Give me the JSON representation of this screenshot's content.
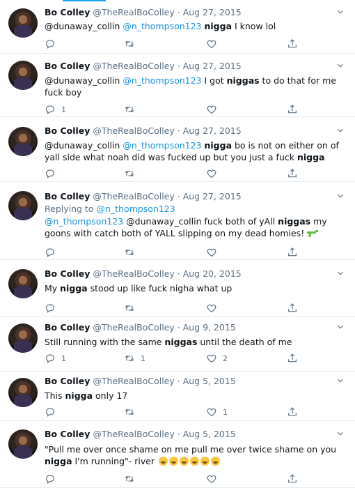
{
  "tweets": [
    {
      "name": "Bo Colley",
      "handle": "@TheRealBoColley",
      "sep": "·",
      "date": "Aug 27, 2015",
      "reply_label": "",
      "reply_to": "",
      "segments": [
        {
          "t": "@dunaway_collin ",
          "s": "text"
        },
        {
          "t": "@n_thompson123",
          "s": "mention"
        },
        {
          "t": " ",
          "s": "text"
        },
        {
          "t": "nigga",
          "s": "bold"
        },
        {
          "t": " I know lol",
          "s": "text"
        }
      ],
      "counts": {
        "replies": "",
        "retweets": "",
        "likes": ""
      }
    },
    {
      "name": "Bo Colley",
      "handle": "@TheRealBoColley",
      "sep": "·",
      "date": "Aug 27, 2015",
      "reply_label": "",
      "reply_to": "",
      "segments": [
        {
          "t": "@dunaway_collin ",
          "s": "text"
        },
        {
          "t": "@n_thompson123",
          "s": "mention"
        },
        {
          "t": " I got ",
          "s": "text"
        },
        {
          "t": "niggas",
          "s": "bold"
        },
        {
          "t": " to do that for me fuck boy",
          "s": "text"
        }
      ],
      "counts": {
        "replies": "1",
        "retweets": "",
        "likes": ""
      }
    },
    {
      "name": "Bo Colley",
      "handle": "@TheRealBoColley",
      "sep": "·",
      "date": "Aug 27, 2015",
      "reply_label": "",
      "reply_to": "",
      "segments": [
        {
          "t": "@dunaway_collin ",
          "s": "text"
        },
        {
          "t": "@n_thompson123",
          "s": "mention"
        },
        {
          "t": " ",
          "s": "text"
        },
        {
          "t": "nigga",
          "s": "bold"
        },
        {
          "t": " bo is not on either on of yall side what noah did was fucked up but you just a fuck ",
          "s": "text"
        },
        {
          "t": "nigga",
          "s": "bold"
        }
      ],
      "counts": {
        "replies": "",
        "retweets": "",
        "likes": ""
      }
    },
    {
      "name": "Bo Colley",
      "handle": "@TheRealBoColley",
      "sep": "·",
      "date": "Aug 27, 2015",
      "reply_label": "Replying to ",
      "reply_to": "@n_thompson123",
      "segments": [
        {
          "t": "@n_thompson123",
          "s": "mention"
        },
        {
          "t": " @dunaway_collin fuck both of yAll ",
          "s": "text"
        },
        {
          "t": "niggas",
          "s": "bold"
        },
        {
          "t": " my goons with catch both of YALL slipping on my dead homies! ",
          "s": "text"
        },
        {
          "t": "",
          "s": "gun"
        }
      ],
      "counts": {
        "replies": "",
        "retweets": "",
        "likes": ""
      }
    },
    {
      "name": "Bo Colley",
      "handle": "@TheRealBoColley",
      "sep": "·",
      "date": "Aug 20, 2015",
      "reply_label": "",
      "reply_to": "",
      "segments": [
        {
          "t": "My ",
          "s": "text"
        },
        {
          "t": "nigga",
          "s": "bold"
        },
        {
          "t": " stood up like fuck nigha what up",
          "s": "text"
        }
      ],
      "counts": {
        "replies": "",
        "retweets": "",
        "likes": ""
      }
    },
    {
      "name": "Bo Colley",
      "handle": "@TheRealBoColley",
      "sep": "·",
      "date": "Aug 9, 2015",
      "reply_label": "",
      "reply_to": "",
      "segments": [
        {
          "t": "Still running with the same ",
          "s": "text"
        },
        {
          "t": "niggas",
          "s": "bold"
        },
        {
          "t": " until the death of me",
          "s": "text"
        }
      ],
      "counts": {
        "replies": "1",
        "retweets": "1",
        "likes": "2"
      }
    },
    {
      "name": "Bo Colley",
      "handle": "@TheRealBoColley",
      "sep": "·",
      "date": "Aug 5, 2015",
      "reply_label": "",
      "reply_to": "",
      "segments": [
        {
          "t": "This ",
          "s": "text"
        },
        {
          "t": "nigga",
          "s": "bold"
        },
        {
          "t": " only 17",
          "s": "text"
        }
      ],
      "counts": {
        "replies": "",
        "retweets": "",
        "likes": "1"
      }
    },
    {
      "name": "Bo Colley",
      "handle": "@TheRealBoColley",
      "sep": "·",
      "date": "Aug 5, 2015",
      "reply_label": "",
      "reply_to": "",
      "segments": [
        {
          "t": "\"Pull me over once shame on me pull me over twice shame on you ",
          "s": "text"
        },
        {
          "t": "nigga",
          "s": "bold"
        },
        {
          "t": " I'm running\"- river  ",
          "s": "text"
        },
        {
          "t": "",
          "s": "emoji"
        },
        {
          "t": "",
          "s": "emoji"
        },
        {
          "t": "",
          "s": "emoji"
        },
        {
          "t": "",
          "s": "emoji"
        },
        {
          "t": "",
          "s": "emoji"
        },
        {
          "t": "",
          "s": "emoji"
        }
      ],
      "counts": {
        "replies": "",
        "retweets": "",
        "likes": ""
      }
    }
  ],
  "icons": {
    "reply": "reply-icon",
    "retweet": "retweet-icon",
    "like": "heart-icon",
    "share": "share-icon",
    "more": "chevron-down-icon",
    "avatar": "avatar",
    "gun": "water-pistol-emoji",
    "emoji": "face-with-tears-of-joy-emoji"
  },
  "colors": {
    "mention": "#1b95e0",
    "muted": "#5b7083",
    "divider": "#e6ecf0",
    "accent": "#1da1f2"
  }
}
